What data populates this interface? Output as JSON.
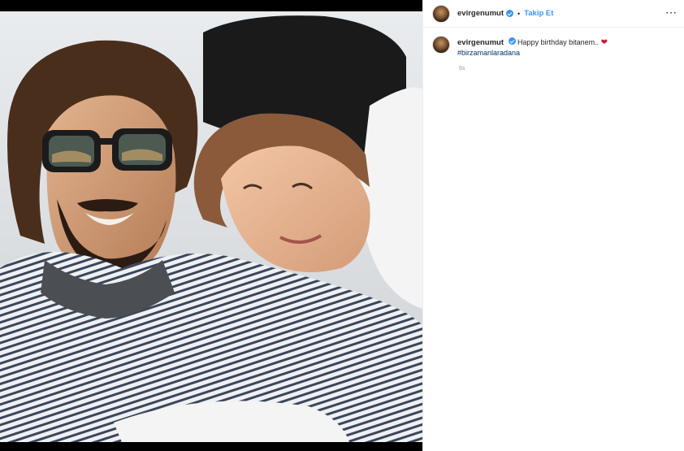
{
  "post": {
    "username": "evirgenumut",
    "verified": true,
    "separator": "•",
    "follow_label": "Takip Et",
    "more_icon": "⋯",
    "caption": {
      "username": "evirgenumut",
      "text": "Happy birthday bitanem..",
      "emoji": "❤",
      "hashtag": "#birzamanlaradana"
    },
    "timestamp": "6s"
  },
  "colors": {
    "accent": "#3897f0",
    "text": "#262626",
    "hashtag": "#003569",
    "heart": "#c21c2c"
  }
}
